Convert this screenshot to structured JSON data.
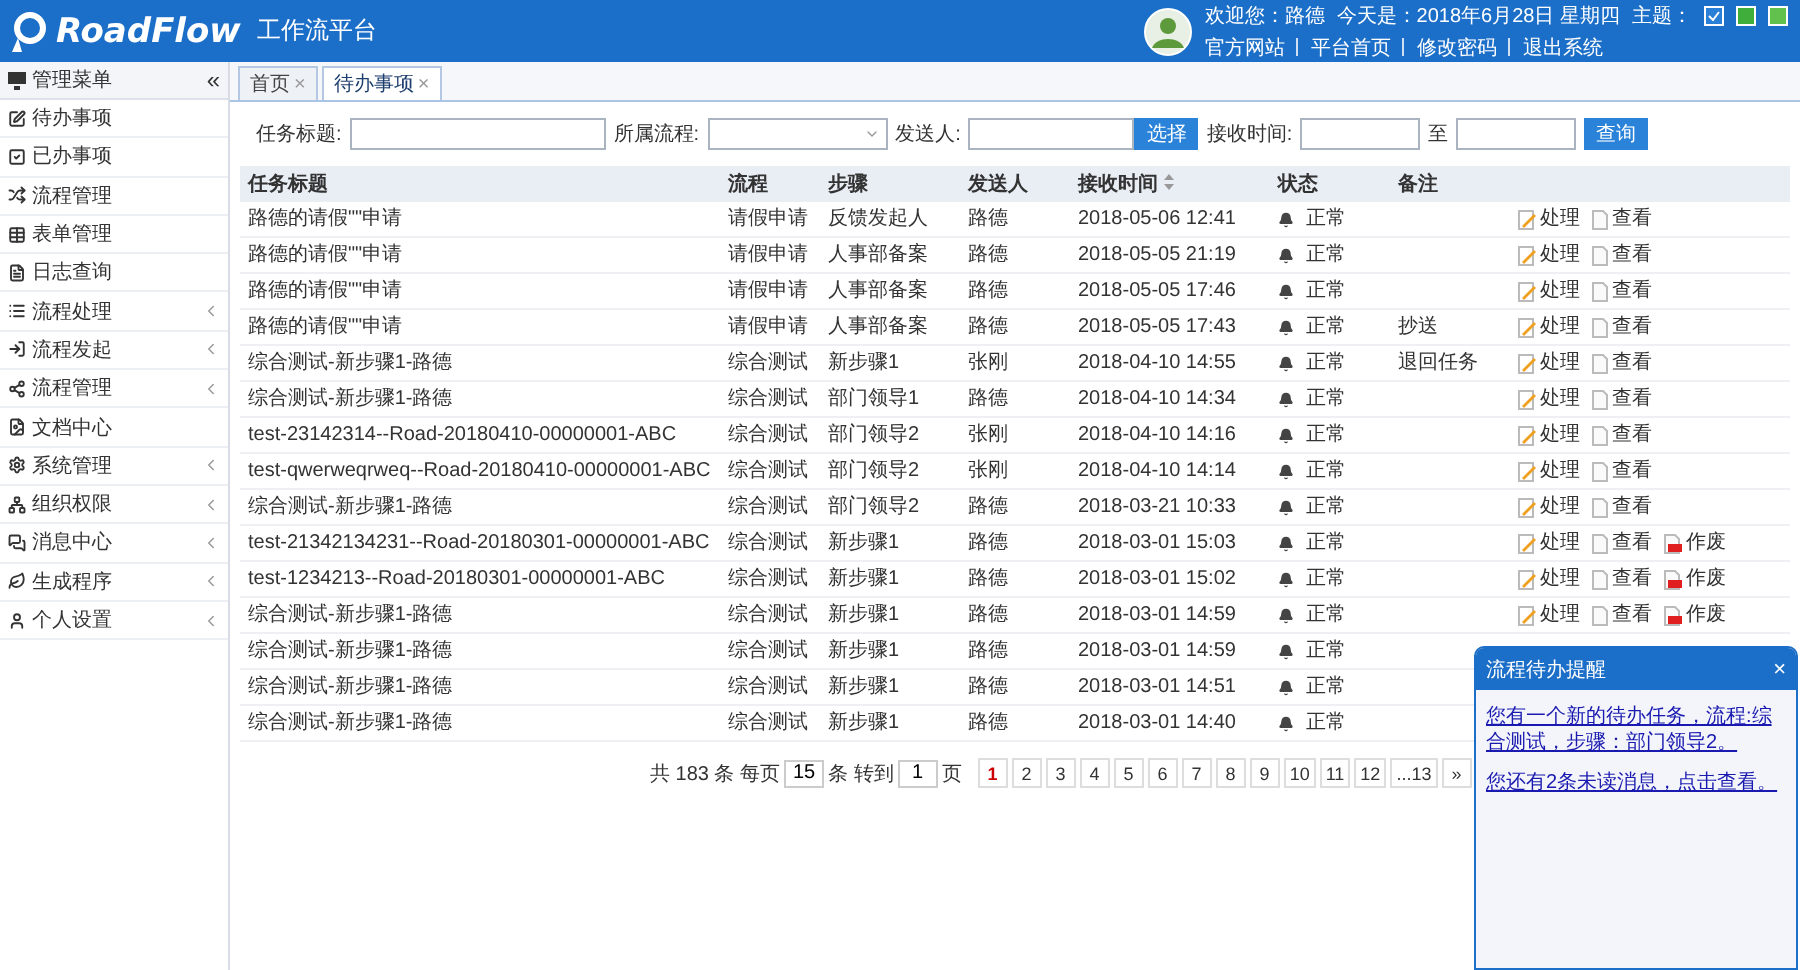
{
  "header": {
    "logo": "RoadFlow",
    "subtitle": "工作流平台",
    "welcome": "欢迎您：路德",
    "today": "今天是：2018年6月28日 星期四",
    "theme_label": "主题：",
    "themes": [
      {
        "color": "#2a7fd6",
        "selected": true
      },
      {
        "color": "#3fae3a",
        "selected": false
      },
      {
        "color": "#62c04d",
        "selected": false
      }
    ],
    "links": [
      "官方网站",
      "平台首页",
      "修改密码",
      "退出系统"
    ]
  },
  "sidebar": {
    "title": "管理菜单",
    "collapse": "«",
    "items": [
      {
        "label": "待办事项",
        "has_submenu": false
      },
      {
        "label": "已办事项",
        "has_submenu": false
      },
      {
        "label": "流程管理",
        "has_submenu": false
      },
      {
        "label": "表单管理",
        "has_submenu": false
      },
      {
        "label": "日志查询",
        "has_submenu": false
      },
      {
        "label": "流程处理",
        "has_submenu": true
      },
      {
        "label": "流程发起",
        "has_submenu": true
      },
      {
        "label": "流程管理",
        "has_submenu": true
      },
      {
        "label": "文档中心",
        "has_submenu": false
      },
      {
        "label": "系统管理",
        "has_submenu": true
      },
      {
        "label": "组织权限",
        "has_submenu": true
      },
      {
        "label": "消息中心",
        "has_submenu": true
      },
      {
        "label": "生成程序",
        "has_submenu": true
      },
      {
        "label": "个人设置",
        "has_submenu": true
      }
    ]
  },
  "tabs": [
    {
      "label": "首页",
      "close": "×",
      "selected": false
    },
    {
      "label": "待办事项",
      "close": "×",
      "selected": true
    }
  ],
  "filters": {
    "title_label": "任务标题:",
    "flow_label": "所属流程:",
    "sender_label": "发送人:",
    "choose_button": "选择",
    "time_label": "接收时间:",
    "to_label": "至",
    "search_button": "查询"
  },
  "table": {
    "columns": [
      {
        "label": "任务标题",
        "sortable": false
      },
      {
        "label": "流程",
        "sortable": false
      },
      {
        "label": "步骤",
        "sortable": false
      },
      {
        "label": "发送人",
        "sortable": false
      },
      {
        "label": "接收时间",
        "sortable": true
      },
      {
        "label": "状态",
        "sortable": false
      },
      {
        "label": "备注",
        "sortable": false
      }
    ],
    "rows": [
      {
        "title": "路德的请假\"\"申请",
        "flow": "请假申请",
        "step": "反馈发起人",
        "sender": "路德",
        "time": "2018-05-06 12:41",
        "status": "正常",
        "note": "",
        "actions": [
          "处理",
          "查看"
        ]
      },
      {
        "title": "路德的请假\"\"申请",
        "flow": "请假申请",
        "step": "人事部备案",
        "sender": "路德",
        "time": "2018-05-05 21:19",
        "status": "正常",
        "note": "",
        "actions": [
          "处理",
          "查看"
        ]
      },
      {
        "title": "路德的请假\"\"申请",
        "flow": "请假申请",
        "step": "人事部备案",
        "sender": "路德",
        "time": "2018-05-05 17:46",
        "status": "正常",
        "note": "",
        "actions": [
          "处理",
          "查看"
        ]
      },
      {
        "title": "路德的请假\"\"申请",
        "flow": "请假申请",
        "step": "人事部备案",
        "sender": "路德",
        "time": "2018-05-05 17:43",
        "status": "正常",
        "note": "抄送",
        "actions": [
          "处理",
          "查看"
        ]
      },
      {
        "title": "综合测试-新步骤1-路德",
        "flow": "综合测试",
        "step": "新步骤1",
        "sender": "张刚",
        "time": "2018-04-10 14:55",
        "status": "正常",
        "note": "退回任务",
        "actions": [
          "处理",
          "查看"
        ]
      },
      {
        "title": "综合测试-新步骤1-路德",
        "flow": "综合测试",
        "step": "部门领导1",
        "sender": "路德",
        "time": "2018-04-10 14:34",
        "status": "正常",
        "note": "",
        "actions": [
          "处理",
          "查看"
        ]
      },
      {
        "title": "test-23142314--Road-20180410-00000001-ABC",
        "flow": "综合测试",
        "step": "部门领导2",
        "sender": "张刚",
        "time": "2018-04-10 14:16",
        "status": "正常",
        "note": "",
        "actions": [
          "处理",
          "查看"
        ]
      },
      {
        "title": "test-qwerweqrweq--Road-20180410-00000001-ABC",
        "flow": "综合测试",
        "step": "部门领导2",
        "sender": "张刚",
        "time": "2018-04-10 14:14",
        "status": "正常",
        "note": "",
        "actions": [
          "处理",
          "查看"
        ]
      },
      {
        "title": "综合测试-新步骤1-路德",
        "flow": "综合测试",
        "step": "部门领导2",
        "sender": "路德",
        "time": "2018-03-21 10:33",
        "status": "正常",
        "note": "",
        "actions": [
          "处理",
          "查看"
        ]
      },
      {
        "title": "test-21342134231--Road-20180301-00000001-ABC",
        "flow": "综合测试",
        "step": "新步骤1",
        "sender": "路德",
        "time": "2018-03-01 15:03",
        "status": "正常",
        "note": "",
        "actions": [
          "处理",
          "查看",
          "作废"
        ]
      },
      {
        "title": "test-1234213--Road-20180301-00000001-ABC",
        "flow": "综合测试",
        "step": "新步骤1",
        "sender": "路德",
        "time": "2018-03-01 15:02",
        "status": "正常",
        "note": "",
        "actions": [
          "处理",
          "查看",
          "作废"
        ]
      },
      {
        "title": "综合测试-新步骤1-路德",
        "flow": "综合测试",
        "step": "新步骤1",
        "sender": "路德",
        "time": "2018-03-01 14:59",
        "status": "正常",
        "note": "",
        "actions": [
          "处理",
          "查看",
          "作废"
        ]
      },
      {
        "title": "综合测试-新步骤1-路德",
        "flow": "综合测试",
        "step": "新步骤1",
        "sender": "路德",
        "time": "2018-03-01 14:59",
        "status": "正常",
        "note": ""
      },
      {
        "title": "综合测试-新步骤1-路德",
        "flow": "综合测试",
        "step": "新步骤1",
        "sender": "路德",
        "time": "2018-03-01 14:51",
        "status": "正常",
        "note": ""
      },
      {
        "title": "综合测试-新步骤1-路德",
        "flow": "综合测试",
        "step": "新步骤1",
        "sender": "路德",
        "time": "2018-03-01 14:40",
        "status": "正常",
        "note": ""
      }
    ]
  },
  "pagination": {
    "total": "共 183 条 每页",
    "per_page": "15",
    "unit_goto": "条 转到",
    "goto": "1",
    "page_word": "页",
    "pages": [
      {
        "label": "1",
        "selected": true
      },
      {
        "label": "2",
        "selected": false
      },
      {
        "label": "3",
        "selected": false
      },
      {
        "label": "4",
        "selected": false
      },
      {
        "label": "5",
        "selected": false
      },
      {
        "label": "6",
        "selected": false
      },
      {
        "label": "7",
        "selected": false
      },
      {
        "label": "8",
        "selected": false
      },
      {
        "label": "9",
        "selected": false
      },
      {
        "label": "10",
        "selected": false
      },
      {
        "label": "11",
        "selected": false
      },
      {
        "label": "12",
        "selected": false
      },
      {
        "label": "...13",
        "selected": false
      }
    ],
    "next": "»"
  },
  "popup": {
    "title": "流程待办提醒",
    "close": "×",
    "messages": [
      "您有一个新的待办任务，流程:综合测试，步骤：部门领导2。",
      "您还有2条未读消息，点击查看。"
    ]
  }
}
